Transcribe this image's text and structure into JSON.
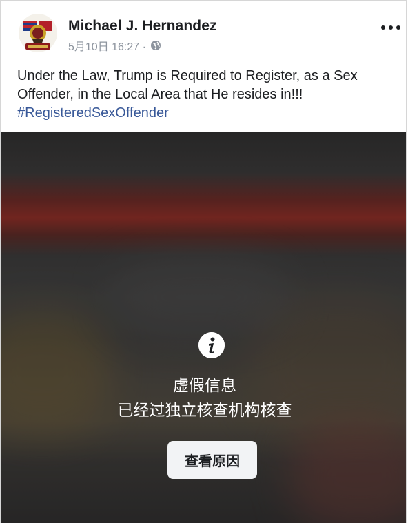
{
  "post": {
    "author_name": "Michael J. Hernandez",
    "timestamp": "5月10日 16:27 ·",
    "privacy_icon": "globe-icon",
    "more_icon": "more-dots-icon",
    "text": "Under the Law, Trump is Required to Register, as a Sex Offender, in the Local Area that He resides in!!!",
    "hashtag": "#RegisteredSexOffender"
  },
  "fact_check": {
    "icon": "info-icon",
    "title": "虚假信息",
    "subtitle": "已经过独立核查机构核查",
    "button_label": "查看原因"
  },
  "colors": {
    "hashtag": "#385898",
    "meta_text": "#8d949e",
    "button_bg": "#f2f3f5"
  }
}
